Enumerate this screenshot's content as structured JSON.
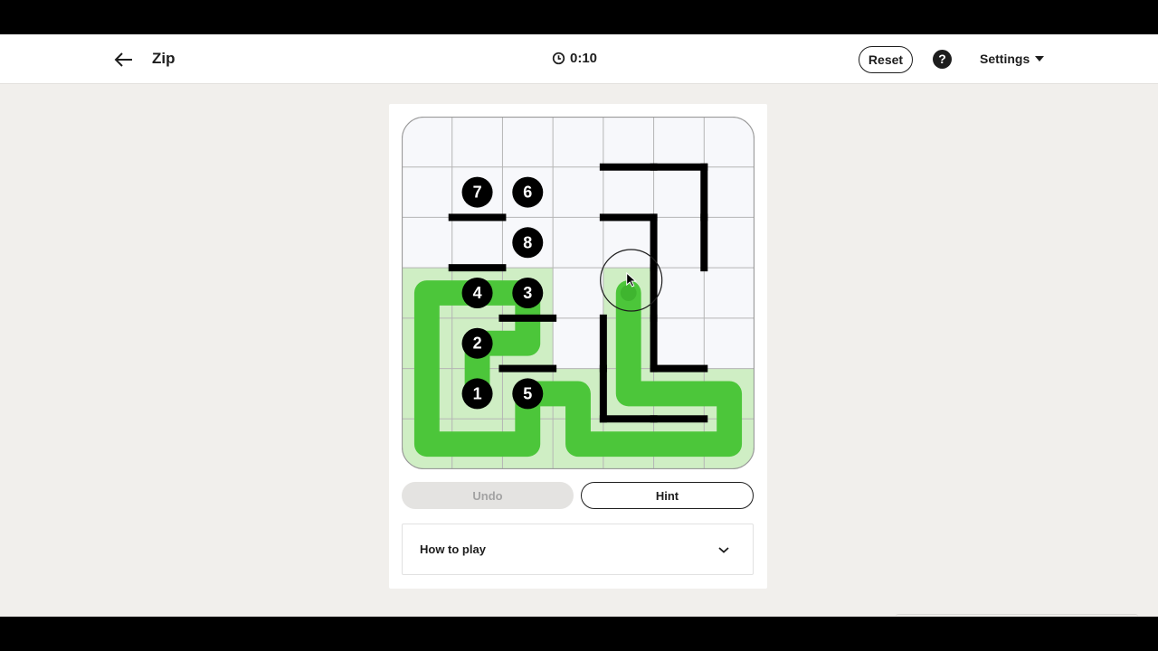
{
  "header": {
    "title": "Zip",
    "timer": "0:10",
    "reset_label": "Reset",
    "help_label": "?",
    "settings_label": "Settings"
  },
  "icons": {
    "back": "arrow-left-icon",
    "timer": "clock-icon",
    "help": "question-mark-icon",
    "settings": "caret-down-icon",
    "howto": "chevron-down-icon"
  },
  "game": {
    "grid_rows": 7,
    "grid_cols": 7,
    "checkpoints": [
      {
        "label": "1",
        "row": 5,
        "col": 1
      },
      {
        "label": "2",
        "row": 4,
        "col": 1
      },
      {
        "label": "3",
        "row": 3,
        "col": 2
      },
      {
        "label": "4",
        "row": 3,
        "col": 1
      },
      {
        "label": "5",
        "row": 5,
        "col": 2
      },
      {
        "label": "6",
        "row": 1,
        "col": 2
      },
      {
        "label": "7",
        "row": 1,
        "col": 1
      },
      {
        "label": "8",
        "row": 2,
        "col": 2
      }
    ],
    "path_cells": [
      [
        5,
        1
      ],
      [
        4,
        1
      ],
      [
        4,
        2
      ],
      [
        3,
        2
      ],
      [
        3,
        1
      ],
      [
        3,
        0
      ],
      [
        4,
        0
      ],
      [
        5,
        0
      ],
      [
        6,
        0
      ],
      [
        6,
        1
      ],
      [
        6,
        2
      ],
      [
        5,
        2
      ],
      [
        5,
        3
      ],
      [
        6,
        3
      ],
      [
        6,
        4
      ],
      [
        6,
        5
      ],
      [
        6,
        6
      ],
      [
        5,
        6
      ],
      [
        5,
        5
      ],
      [
        5,
        4
      ],
      [
        4,
        4
      ],
      [
        3,
        4
      ]
    ],
    "walls": [
      {
        "orientation": "h",
        "row": 2,
        "col": 1
      },
      {
        "orientation": "h",
        "row": 3,
        "col": 1
      },
      {
        "orientation": "h",
        "row": 4,
        "col": 2
      },
      {
        "orientation": "h",
        "row": 5,
        "col": 2
      },
      {
        "orientation": "h",
        "row": 1,
        "col": 4
      },
      {
        "orientation": "h",
        "row": 1,
        "col": 5
      },
      {
        "orientation": "h",
        "row": 2,
        "col": 4
      },
      {
        "orientation": "h",
        "row": 6,
        "col": 4
      },
      {
        "orientation": "h",
        "row": 6,
        "col": 5
      },
      {
        "orientation": "h",
        "row": 5,
        "col": 5
      },
      {
        "orientation": "v",
        "row": 1,
        "col": 6
      },
      {
        "orientation": "v",
        "row": 2,
        "col": 6
      },
      {
        "orientation": "v",
        "row": 2,
        "col": 5
      },
      {
        "orientation": "v",
        "row": 3,
        "col": 5
      },
      {
        "orientation": "v",
        "row": 4,
        "col": 5
      },
      {
        "orientation": "v",
        "row": 4,
        "col": 4
      },
      {
        "orientation": "v",
        "row": 5,
        "col": 4
      }
    ],
    "colors": {
      "path": "#4cc63a",
      "path_fill": "#cfeec4",
      "path_head": "#3fb52f",
      "grid_line": "#b5b5b5",
      "cell_bg": "#f7f8fb",
      "wall": "#000000",
      "checkpoint": "#000000"
    }
  },
  "controls": {
    "undo_label": "Undo",
    "hint_label": "Hint"
  },
  "howto": {
    "label": "How to play"
  }
}
